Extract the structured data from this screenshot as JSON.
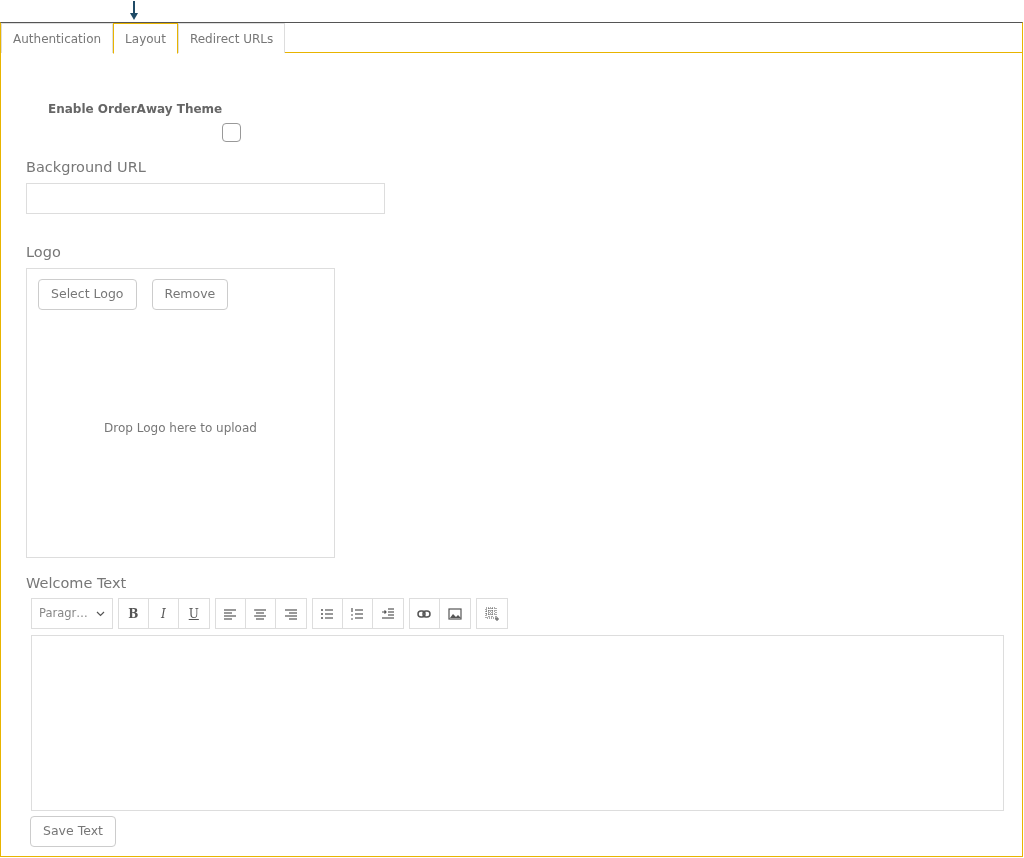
{
  "tabs": [
    {
      "label": "Authentication",
      "selected": false
    },
    {
      "label": "Layout",
      "selected": true
    },
    {
      "label": "Redirect URLs",
      "selected": false
    }
  ],
  "theme_toggle": {
    "label": "Enable OrderAway Theme",
    "checked": false
  },
  "background_url": {
    "label": "Background URL"
  },
  "logo": {
    "label": "Logo",
    "buttons": [
      "Select Logo",
      "Remove"
    ],
    "drop_hint": "Drop Logo here to upload"
  },
  "welcome_text": {
    "label": "Welcome Text",
    "format": "Paragr…",
    "toolbar": [
      [
        {
          "kind": "bold",
          "label": "B"
        },
        {
          "kind": "italic",
          "label": "I"
        },
        {
          "kind": "underline",
          "label": "U"
        }
      ],
      [
        {
          "kind": "align-left"
        },
        {
          "kind": "align-center"
        },
        {
          "kind": "align-right"
        }
      ],
      [
        {
          "kind": "bullet-list"
        },
        {
          "kind": "numbered-list"
        },
        {
          "kind": "indent"
        }
      ],
      [
        {
          "kind": "link"
        },
        {
          "kind": "image"
        }
      ],
      [
        {
          "kind": "table"
        }
      ]
    ]
  },
  "save_button": "Save Text"
}
